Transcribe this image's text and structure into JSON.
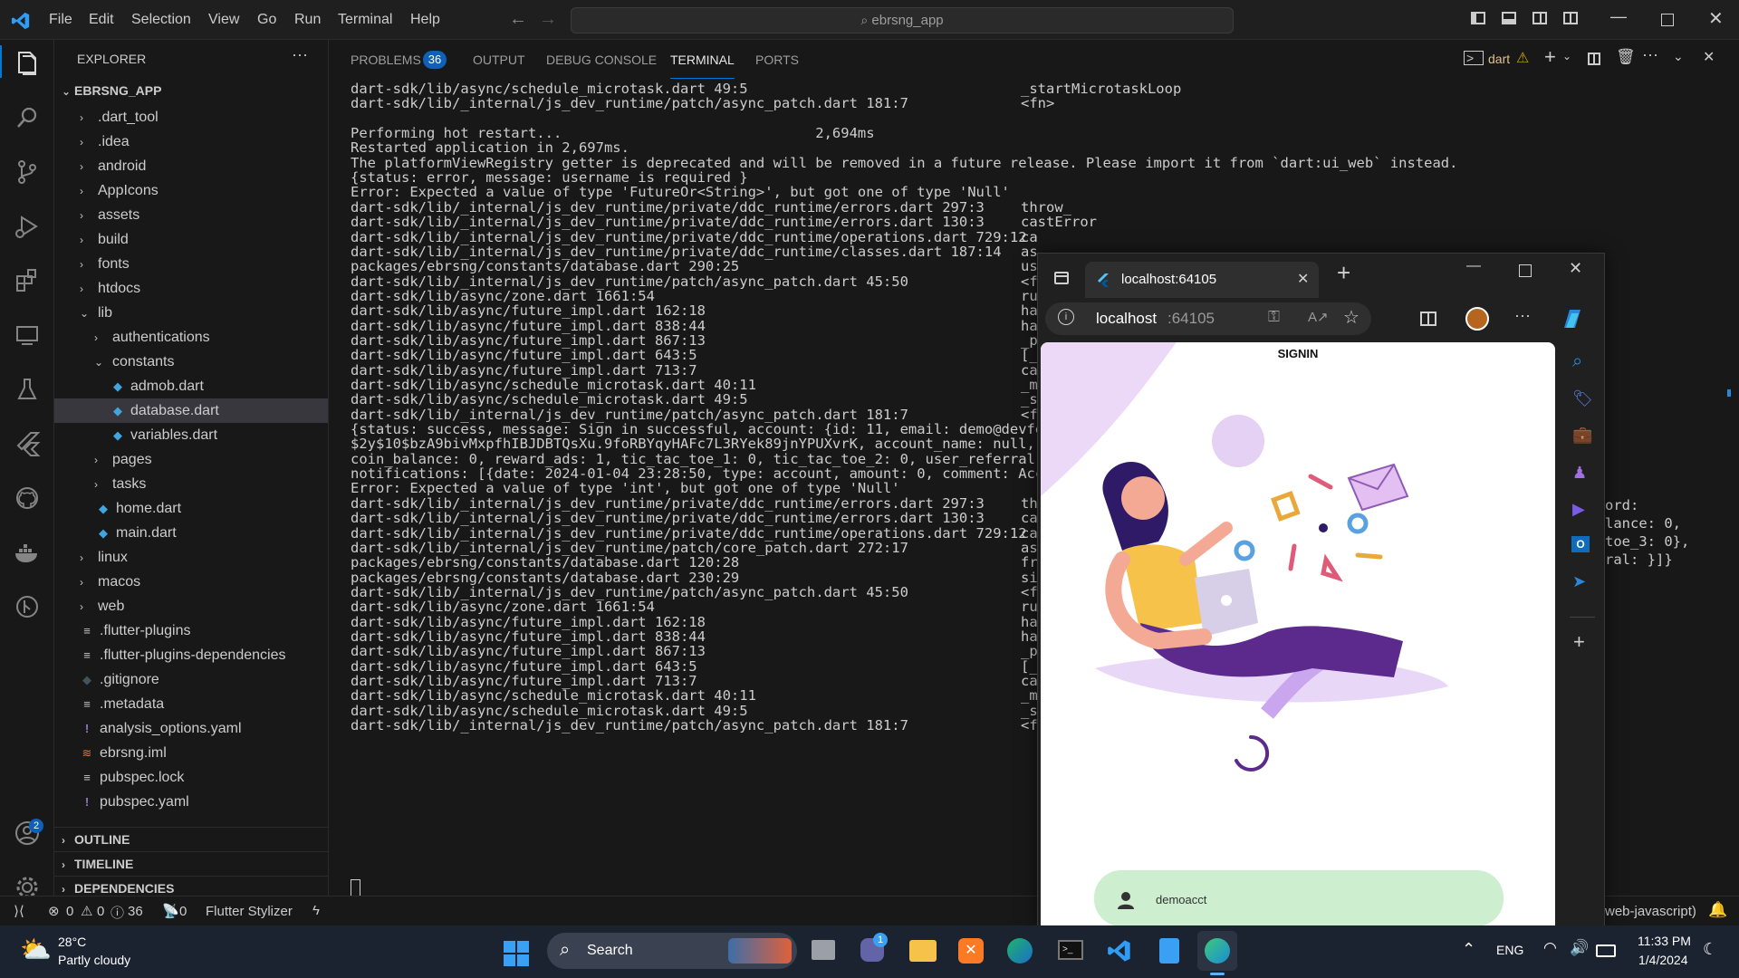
{
  "titlebar": {
    "menu": [
      "File",
      "Edit",
      "Selection",
      "View",
      "Go",
      "Run",
      "Terminal",
      "Help"
    ],
    "search_text": "ebrsng_app"
  },
  "explorer": {
    "header": "EXPLORER",
    "project": "EBRSNG_APP",
    "items": [
      ".dart_tool",
      ".idea",
      "android",
      "AppIcons",
      "assets",
      "build",
      "fonts",
      "htdocs",
      "lib",
      "authentications",
      "constants",
      "admob.dart",
      "database.dart",
      "variables.dart",
      "pages",
      "tasks",
      "home.dart",
      "main.dart",
      "linux",
      "macos",
      "web",
      ".flutter-plugins",
      ".flutter-plugins-dependencies",
      ".gitignore",
      ".metadata",
      "analysis_options.yaml",
      "ebrsng.iml",
      "pubspec.lock",
      "pubspec.yaml"
    ],
    "sections": [
      "OUTLINE",
      "TIMELINE",
      "DEPENDENCIES"
    ]
  },
  "panel": {
    "tabs": [
      "PROBLEMS",
      "OUTPUT",
      "DEBUG CONSOLE",
      "TERMINAL",
      "PORTS"
    ],
    "problems_count": "36",
    "terminal_name": "dart"
  },
  "terminal_lines": [
    {
      "l": "dart-sdk/lib/async/schedule_microtask.dart 49:5",
      "r": "_startMicrotaskLoop"
    },
    {
      "l": "dart-sdk/lib/_internal/js_dev_runtime/patch/async_patch.dart 181:7",
      "r": "<fn>"
    },
    {
      "l": "",
      "r": ""
    },
    {
      "l": "Performing hot restart...                              2,694ms",
      "r": ""
    },
    {
      "l": "Restarted application in 2,697ms.",
      "r": ""
    },
    {
      "l": "The platformViewRegistry getter is deprecated and will be removed in a future release. Please import it from `dart:ui_web` instead.",
      "r": ""
    },
    {
      "l": "{status: error, message: username is required }",
      "r": ""
    },
    {
      "l": "Error: Expected a value of type 'FutureOr<String>', but got one of type 'Null'",
      "r": ""
    },
    {
      "l": "dart-sdk/lib/_internal/js_dev_runtime/private/ddc_runtime/errors.dart 297:3",
      "r": "throw_"
    },
    {
      "l": "dart-sdk/lib/_internal/js_dev_runtime/private/ddc_runtime/errors.dart 130:3",
      "r": "castError"
    },
    {
      "l": "dart-sdk/lib/_internal/js_dev_runtime/private/ddc_runtime/operations.dart 729:12",
      "r": "ca"
    },
    {
      "l": "dart-sdk/lib/_internal/js_dev_runtime/private/ddc_runtime/classes.dart 187:14",
      "r": "as"
    },
    {
      "l": "packages/ebrsng/constants/database.dart 290:25",
      "r": "us"
    },
    {
      "l": "dart-sdk/lib/_internal/js_dev_runtime/patch/async_patch.dart 45:50",
      "r": "<f"
    },
    {
      "l": "dart-sdk/lib/async/zone.dart 1661:54",
      "r": "ru"
    },
    {
      "l": "dart-sdk/lib/async/future_impl.dart 162:18",
      "r": "ha"
    },
    {
      "l": "dart-sdk/lib/async/future_impl.dart 838:44",
      "r": "ha"
    },
    {
      "l": "dart-sdk/lib/async/future_impl.dart 867:13",
      "r": "_p"
    },
    {
      "l": "dart-sdk/lib/async/future_impl.dart 643:5",
      "r": "[_"
    },
    {
      "l": "dart-sdk/lib/async/future_impl.dart 713:7",
      "r": "ca"
    },
    {
      "l": "dart-sdk/lib/async/schedule_microtask.dart 40:11",
      "r": "_m"
    },
    {
      "l": "dart-sdk/lib/async/schedule_microtask.dart 49:5",
      "r": "_s"
    },
    {
      "l": "dart-sdk/lib/_internal/js_dev_runtime/patch/async_patch.dart 181:7",
      "r": "<f"
    },
    {
      "l": "{status: success, message: Sign in successful, account: {id: 11, email: demo@devfemi",
      "r": ""
    },
    {
      "l": "$2y$10$bzA9bivMxpfhIBJDBTQsXu.9foRBYqyHAFc7L3RYek89jnYPUXvrK, account_name: null, ac",
      "r": ""
    },
    {
      "l": "coin_balance: 0, reward_ads: 1, tic_tac_toe_1: 0, tic_tac_toe_2: 0, user_referral: 1",
      "r": ""
    },
    {
      "l": "notifications: [{date: 2024-01-04 23:28:50, type: account, amount: 0, comment: Accou",
      "r": ""
    },
    {
      "l": "Error: Expected a value of type 'int', but got one of type 'Null'",
      "r": ""
    },
    {
      "l": "dart-sdk/lib/_internal/js_dev_runtime/private/ddc_runtime/errors.dart 297:3",
      "r": "th"
    },
    {
      "l": "dart-sdk/lib/_internal/js_dev_runtime/private/ddc_runtime/errors.dart 130:3",
      "r": "ca"
    },
    {
      "l": "dart-sdk/lib/_internal/js_dev_runtime/private/ddc_runtime/operations.dart 729:12",
      "r": "ca"
    },
    {
      "l": "dart-sdk/lib/_internal/js_dev_runtime/patch/core_patch.dart 272:17",
      "r": "as"
    },
    {
      "l": "packages/ebrsng/constants/database.dart 120:28",
      "r": "fr"
    },
    {
      "l": "packages/ebrsng/constants/database.dart 230:29",
      "r": "si"
    },
    {
      "l": "dart-sdk/lib/_internal/js_dev_runtime/patch/async_patch.dart 45:50",
      "r": "<f"
    },
    {
      "l": "dart-sdk/lib/async/zone.dart 1661:54",
      "r": "ru"
    },
    {
      "l": "dart-sdk/lib/async/future_impl.dart 162:18",
      "r": "ha"
    },
    {
      "l": "dart-sdk/lib/async/future_impl.dart 838:44",
      "r": "ha"
    },
    {
      "l": "dart-sdk/lib/async/future_impl.dart 867:13",
      "r": "_p"
    },
    {
      "l": "dart-sdk/lib/async/future_impl.dart 643:5",
      "r": "[_"
    },
    {
      "l": "dart-sdk/lib/async/future_impl.dart 713:7",
      "r": "ca"
    },
    {
      "l": "dart-sdk/lib/async/schedule_microtask.dart 40:11",
      "r": "_m"
    },
    {
      "l": "dart-sdk/lib/async/schedule_microtask.dart 49:5",
      "r": "_s"
    },
    {
      "l": "dart-sdk/lib/_internal/js_dev_runtime/patch/async_patch.dart 181:7",
      "r": "<f"
    }
  ],
  "terminal_overflow": [
    "ord:",
    "lance: 0,",
    "toe_3: 0},",
    "ral: }]}"
  ],
  "statusbar": {
    "errors": "0",
    "warnings": "0",
    "infos": "36",
    "ports": "0",
    "extension": "Flutter Stylizer",
    "language": "web-javascript)"
  },
  "browser": {
    "tab_title": "localhost:64105",
    "url_host": "localhost",
    "url_port": ":64105",
    "page_title": "SIGNIN",
    "username": "demoacct"
  },
  "taskbar": {
    "temperature": "28°C",
    "weather": "Partly cloudy",
    "search_label": "Search",
    "language": "ENG",
    "time": "11:33 PM",
    "date": "1/4/2024",
    "chat_badge": "1"
  },
  "accounts_badge": "2",
  "colors": {
    "accent_blue": "#0078d4",
    "badge_blue": "#0e61b6",
    "page_purple": "#5b2a8c",
    "login_field": "#cdeecf"
  }
}
